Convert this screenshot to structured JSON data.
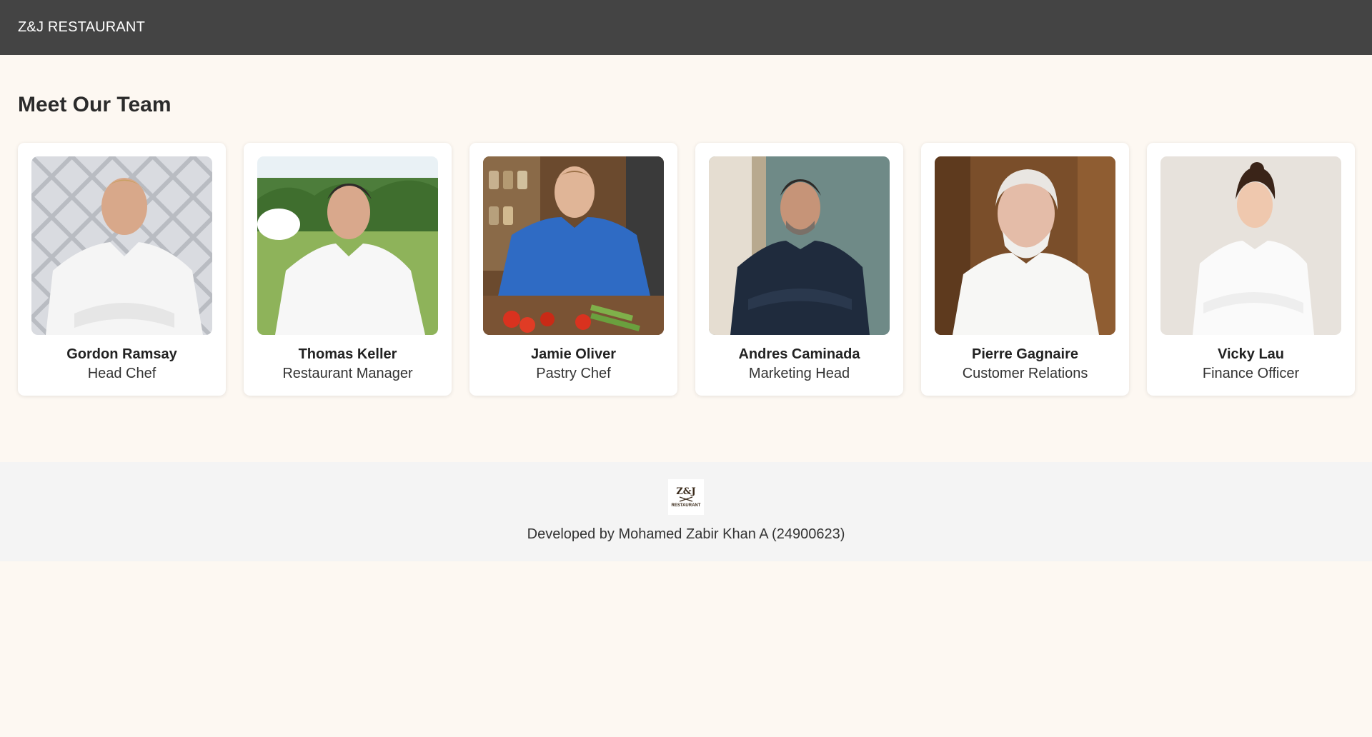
{
  "header": {
    "brand": "Z&J RESTAURANT"
  },
  "main": {
    "title": "Meet Our Team",
    "members": [
      {
        "name": "Gordon Ramsay",
        "role": "Head Chef"
      },
      {
        "name": "Thomas Keller",
        "role": "Restaurant Manager"
      },
      {
        "name": "Jamie Oliver",
        "role": "Pastry Chef"
      },
      {
        "name": "Andres Caminada",
        "role": "Marketing Head"
      },
      {
        "name": "Pierre Gagnaire",
        "role": "Customer Relations"
      },
      {
        "name": "Vicky Lau",
        "role": "Finance Officer"
      }
    ]
  },
  "footer": {
    "logo_text": "Z&J",
    "logo_subtext": "RESTAURANT",
    "credit": "Developed by Mohamed Zabir Khan A (24900623)"
  },
  "colors": {
    "header_bg": "#444444",
    "page_bg": "#fdf8f2",
    "footer_bg": "#f4f4f4"
  }
}
